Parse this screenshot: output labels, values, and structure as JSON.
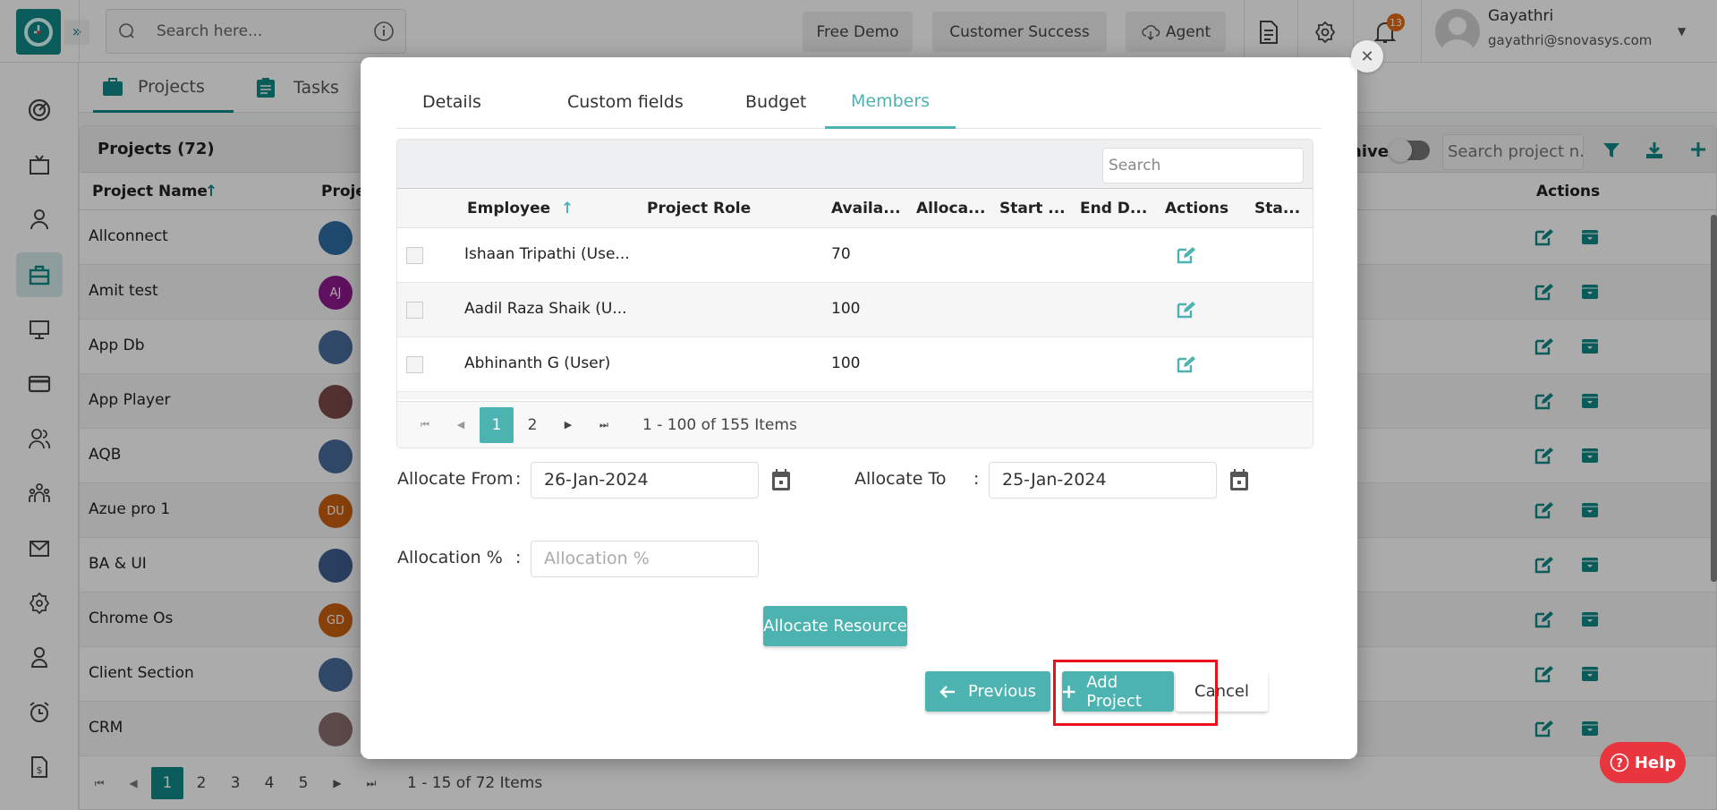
{
  "topbar": {
    "search_placeholder": "Search here...",
    "buttons": [
      "Free Demo",
      "Customer Success",
      "Agent"
    ],
    "notification_count": "13",
    "user_name": "Gayathri",
    "user_email": "gayathri@snovasys.com"
  },
  "sidebar": {
    "items": [
      "dashboard",
      "live-screen",
      "employees",
      "projects",
      "activity",
      "billing",
      "users",
      "teams",
      "mail",
      "settings",
      "clients",
      "timesheet",
      "invoices"
    ]
  },
  "page_tabs": [
    "Projects",
    "Tasks"
  ],
  "projects_grid": {
    "title": "Projects (72)",
    "archive_label": "hive",
    "search_placeholder": "Search project n...",
    "columns": [
      "Project Name",
      "Proje",
      "Actions"
    ],
    "rows": [
      {
        "name": "Allconnect",
        "initials": "",
        "color": "#2f6ea5"
      },
      {
        "name": "Amit test",
        "initials": "AJ",
        "color": "#8e1a8e"
      },
      {
        "name": "App Db",
        "initials": "",
        "color": "#4a6d9c"
      },
      {
        "name": "App Player",
        "initials": "",
        "color": "#7c4a4a"
      },
      {
        "name": "AQB",
        "initials": "",
        "color": "#4a6d9c"
      },
      {
        "name": "Azue pro 1",
        "initials": "DU",
        "color": "#c9600f"
      },
      {
        "name": "BA & UI",
        "initials": "",
        "color": "#3f5f8f"
      },
      {
        "name": "Chrome Os",
        "initials": "GD",
        "color": "#c9600f"
      },
      {
        "name": "Client Section",
        "initials": "",
        "color": "#4a6d9c"
      },
      {
        "name": "CRM",
        "initials": "",
        "color": "#8a6d6d"
      }
    ],
    "pages": [
      "1",
      "2",
      "3",
      "4",
      "5"
    ],
    "current_page": "1",
    "summary": "1 - 15 of 72 Items"
  },
  "modal": {
    "tabs": [
      "Details",
      "Custom fields",
      "Budget",
      "Members"
    ],
    "active_tab": "Members",
    "search_placeholder": "Search",
    "columns": [
      "Employee",
      "Project Role",
      "Availa...",
      "Alloca...",
      "Start ...",
      "End D...",
      "Actions",
      "Sta..."
    ],
    "rows": [
      {
        "employee": "Ishaan Tripathi (Use...",
        "role": "",
        "available": "70"
      },
      {
        "employee": "Aadil Raza Shaik (U...",
        "role": "",
        "available": "100"
      },
      {
        "employee": "Abhinanth G (User)",
        "role": "",
        "available": "100"
      }
    ],
    "pages": [
      "1",
      "2"
    ],
    "current_page": "1",
    "summary": "1 - 100 of 155 Items",
    "allocate_from_label": "Allocate From",
    "allocate_from_value": "26-Jan-2024",
    "allocate_to_label": "Allocate To",
    "allocate_to_value": "25-Jan-2024",
    "allocation_label": "Allocation %",
    "allocation_placeholder": "Allocation %",
    "colon": ":",
    "allocate_button": "Allocate Resource",
    "previous_button": "Previous",
    "add_project_button": "Add Project",
    "cancel_button": "Cancel"
  },
  "help_label": "Help",
  "colors": {
    "accent": "#4cb3b0",
    "brand": "#0f8a87",
    "highlight": "#e8101a",
    "help": "#e8353e"
  }
}
